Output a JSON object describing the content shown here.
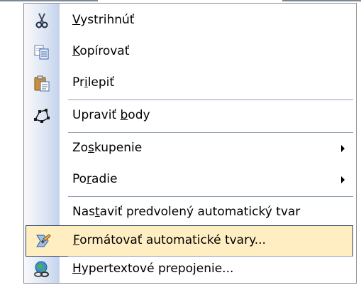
{
  "menu": {
    "items": [
      {
        "pre": "",
        "key": "V",
        "post": "ystrihnúť",
        "icon": "scissors-icon"
      },
      {
        "pre": "",
        "key": "K",
        "post": "opírovať",
        "icon": "copy-icon"
      },
      {
        "pre": "Pr",
        "key": "i",
        "post": "lepiť",
        "icon": "paste-icon"
      },
      {
        "pre": "Upraviť ",
        "key": "b",
        "post": "ody",
        "icon": "edit-points-icon"
      },
      {
        "pre": "Zo",
        "key": "s",
        "post": "kupenie",
        "submenu": true
      },
      {
        "pre": "Po",
        "key": "r",
        "post": "adie",
        "submenu": true
      },
      {
        "pre": "Nas",
        "key": "t",
        "post": "aviť predvolený automatický tvar"
      },
      {
        "pre": "",
        "key": "F",
        "post": "ormátovať automatické tvary...",
        "icon": "format-shape-icon",
        "highlighted": true
      },
      {
        "pre": "",
        "key": "H",
        "post": "ypertextové prepojenie...",
        "icon": "hyperlink-icon"
      }
    ]
  },
  "colors": {
    "highlight_bg": "#ffeec2",
    "highlight_border": "#2a3f63",
    "separator": "#8e9fb6",
    "gutter": "#c3d3ec"
  }
}
